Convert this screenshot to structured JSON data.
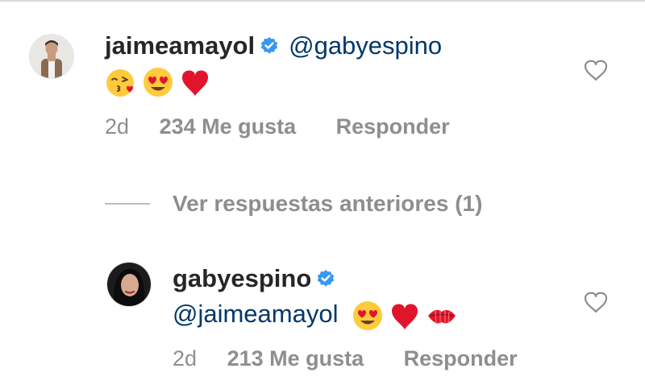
{
  "comments": [
    {
      "username": "jaimeamayol",
      "verified": true,
      "mention": "@gabyespino",
      "emojis": [
        "kiss-face",
        "heart-eyes",
        "red-heart"
      ],
      "time": "2d",
      "likes": "234 Me gusta",
      "reply_label": "Responder"
    },
    {
      "username": "gabyespino",
      "verified": true,
      "mention": "@jaimeamayol",
      "emojis": [
        "heart-eyes",
        "red-heart",
        "kiss-lips"
      ],
      "time": "2d",
      "likes": "213 Me gusta",
      "reply_label": "Responder"
    }
  ],
  "view_replies_label": "Ver respuestas anteriores (1)",
  "colors": {
    "text": "#262626",
    "secondary": "#8e8e8e",
    "mention": "#00376b",
    "verified": "#3897f0",
    "heart": "#e0152b"
  }
}
